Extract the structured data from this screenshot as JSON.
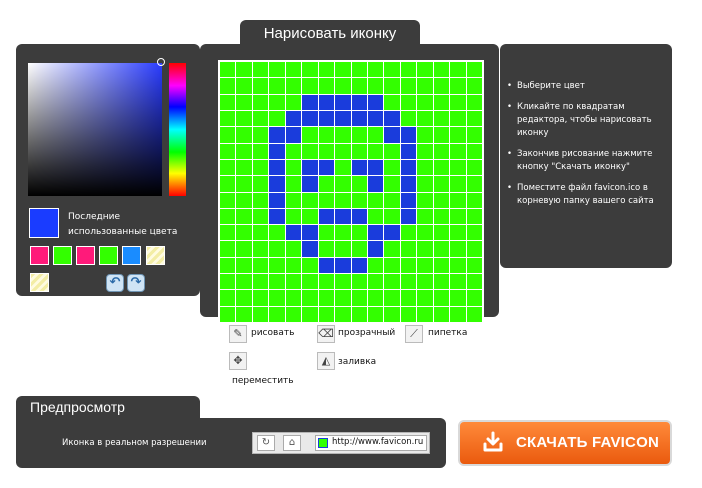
{
  "editor": {
    "title": "Нарисовать иконку",
    "grid": {
      "rows": 16,
      "cols": 16,
      "background_color": "#33ff00",
      "ink_color": "#1a3cdc",
      "filled_cells": [
        [
          2,
          5
        ],
        [
          2,
          6
        ],
        [
          2,
          7
        ],
        [
          2,
          8
        ],
        [
          2,
          9
        ],
        [
          3,
          4
        ],
        [
          3,
          5
        ],
        [
          3,
          6
        ],
        [
          3,
          7
        ],
        [
          3,
          8
        ],
        [
          3,
          9
        ],
        [
          3,
          10
        ],
        [
          4,
          3
        ],
        [
          4,
          4
        ],
        [
          4,
          10
        ],
        [
          4,
          11
        ],
        [
          5,
          3
        ],
        [
          5,
          11
        ],
        [
          6,
          3
        ],
        [
          6,
          5
        ],
        [
          6,
          6
        ],
        [
          6,
          8
        ],
        [
          6,
          9
        ],
        [
          6,
          11
        ],
        [
          7,
          3
        ],
        [
          7,
          5
        ],
        [
          7,
          9
        ],
        [
          7,
          11
        ],
        [
          8,
          3
        ],
        [
          8,
          11
        ],
        [
          9,
          3
        ],
        [
          9,
          6
        ],
        [
          9,
          7
        ],
        [
          9,
          8
        ],
        [
          9,
          11
        ],
        [
          10,
          4
        ],
        [
          10,
          5
        ],
        [
          10,
          9
        ],
        [
          10,
          10
        ],
        [
          11,
          5
        ],
        [
          11,
          9
        ],
        [
          12,
          6
        ],
        [
          12,
          7
        ],
        [
          12,
          8
        ]
      ]
    }
  },
  "color_panel": {
    "current_color": "#1a3cff",
    "recent_label": "Последние использованные цвета",
    "recent_colors": [
      "#ff1a7a",
      "#33ff00",
      "#ff1a7a",
      "#33ff00",
      "#1a8cff",
      "hatch",
      "hatch"
    ],
    "undo_icon": "undo-icon",
    "redo_icon": "redo-icon"
  },
  "instructions": [
    "Выберите цвет",
    "Кликайте по квадратам редактора, чтобы нарисовать иконку",
    "Закончив рисование нажмите кнопку \"Скачать иконку\"",
    "Поместите файл favicon.ico в корневую папку вашего сайта"
  ],
  "tools": {
    "draw": "рисовать",
    "transparent": "прозрачный",
    "eyedropper": "пипетка",
    "move": "переместить",
    "fill": "заливка"
  },
  "preview": {
    "title": "Предпросмотр",
    "label": "Иконка в реальном разрешении",
    "url": "http://www.favicon.ru"
  },
  "download": {
    "label": "СКАЧАТЬ FAVICON"
  }
}
